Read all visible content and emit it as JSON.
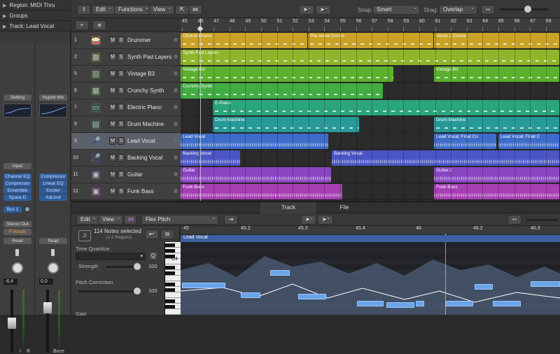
{
  "inspector": {
    "region_header": "Region: MIDI Thru",
    "groups_header": "Groups",
    "track_header": "Track:  Lead Vocal",
    "strip1": {
      "setting": "Setting",
      "input": "Input",
      "plugins": [
        "Channel EQ",
        "Compressor",
        "Ensemble",
        "Space D"
      ],
      "send": "Bus 1",
      "output": "Stereo Out",
      "group": "F.Vocals",
      "automation": "Read",
      "volume": "-6.4",
      "solo": "S",
      "mute_label": "I",
      "r": "R"
    },
    "strip2": {
      "setting": "Hyped Mix",
      "plugins": [
        "Compressor",
        "Linear EQ",
        "Exciter",
        "AdLimit"
      ],
      "automation": "Read",
      "volume": "0.0",
      "name": "Bnce"
    }
  },
  "toolbar": {
    "edit": "Edit",
    "functions": "Functions",
    "view": "View",
    "snap_label": "Snap:",
    "snap_value": "Smart",
    "drag_label": "Drag:",
    "drag_value": "Overlap"
  },
  "ruler_numbers": [
    "45",
    "46",
    "47",
    "48",
    "49",
    "50",
    "51",
    "52",
    "53",
    "54",
    "55",
    "56",
    "57",
    "58",
    "59",
    "60",
    "61",
    "62",
    "63",
    "64",
    "65",
    "66",
    "67",
    "68"
  ],
  "tracks": [
    {
      "num": "1",
      "name": "Drummer",
      "icon": "drummer-icon",
      "color": "#c9a227"
    },
    {
      "num": "2",
      "name": "Synth Pad Layers",
      "icon": "synth-icon",
      "color": "#8fb52b"
    },
    {
      "num": "5",
      "name": "Vintage B3",
      "icon": "organ-icon",
      "color": "#5cb030"
    },
    {
      "num": "6",
      "name": "Crunchy Synth",
      "icon": "synth-icon",
      "color": "#42ad43"
    },
    {
      "num": "7",
      "name": "Electric Piano",
      "icon": "piano-icon",
      "color": "#2ba57b"
    },
    {
      "num": "8",
      "name": "Drum Machine",
      "icon": "drum-machine-icon",
      "color": "#279a98"
    },
    {
      "num": "9",
      "name": "Lead Vocal",
      "icon": "microphone-icon",
      "color": "#3d6cc9"
    },
    {
      "num": "10",
      "name": "Backing Vocal",
      "icon": "microphone-icon",
      "color": "#4b55c4"
    },
    {
      "num": "11",
      "name": "Guitar",
      "icon": "amp-icon",
      "color": "#8a45c0"
    },
    {
      "num": "12",
      "name": "Funk Bass",
      "icon": "bass-amp-icon",
      "color": "#a63eb4"
    }
  ],
  "regions": {
    "drummer": [
      "Chorus Drums",
      "Pre-verse Drums",
      "Verse 2 Drums"
    ],
    "synth": [
      "Synth Pad Layers"
    ],
    "b3": [
      "Vintage B3",
      "Vintage B3"
    ],
    "crunchy": [
      "Crunchy Synth"
    ],
    "epiano": [
      "E-Piano"
    ],
    "drum_machine": [
      "Drum Machine",
      "Drum Machine"
    ],
    "lead_vocal": [
      "Lead Vocal",
      "Lead Vocal: Final Co",
      "Lead Vocal: Final C"
    ],
    "backing": [
      "Backing Vocal",
      "Backing Vocal"
    ],
    "guitar": [
      "Guitar",
      "Guitar.1"
    ],
    "funk_bass": [
      "Funk Bass",
      "Funk Bass"
    ]
  },
  "bottom_tabs": {
    "track": "Track",
    "file": "File"
  },
  "editor": {
    "edit": "Edit",
    "view": "View",
    "mode": "Flex Pitch",
    "selection": "114 Notes selected",
    "selection_sub": "in 2 Regions",
    "time_quantize": "Time Quantize",
    "strength_label": "Strength",
    "strength_value": "100",
    "pitch_correction": "Pitch Correction",
    "pitch_value": "100",
    "gain": "Gain",
    "q": "Q",
    "c4": "C4",
    "region_name": "Lead Vocal",
    "ruler": [
      "45",
      "45.2",
      "45.3",
      "45.4",
      "46",
      "46.2",
      "46.3"
    ]
  }
}
